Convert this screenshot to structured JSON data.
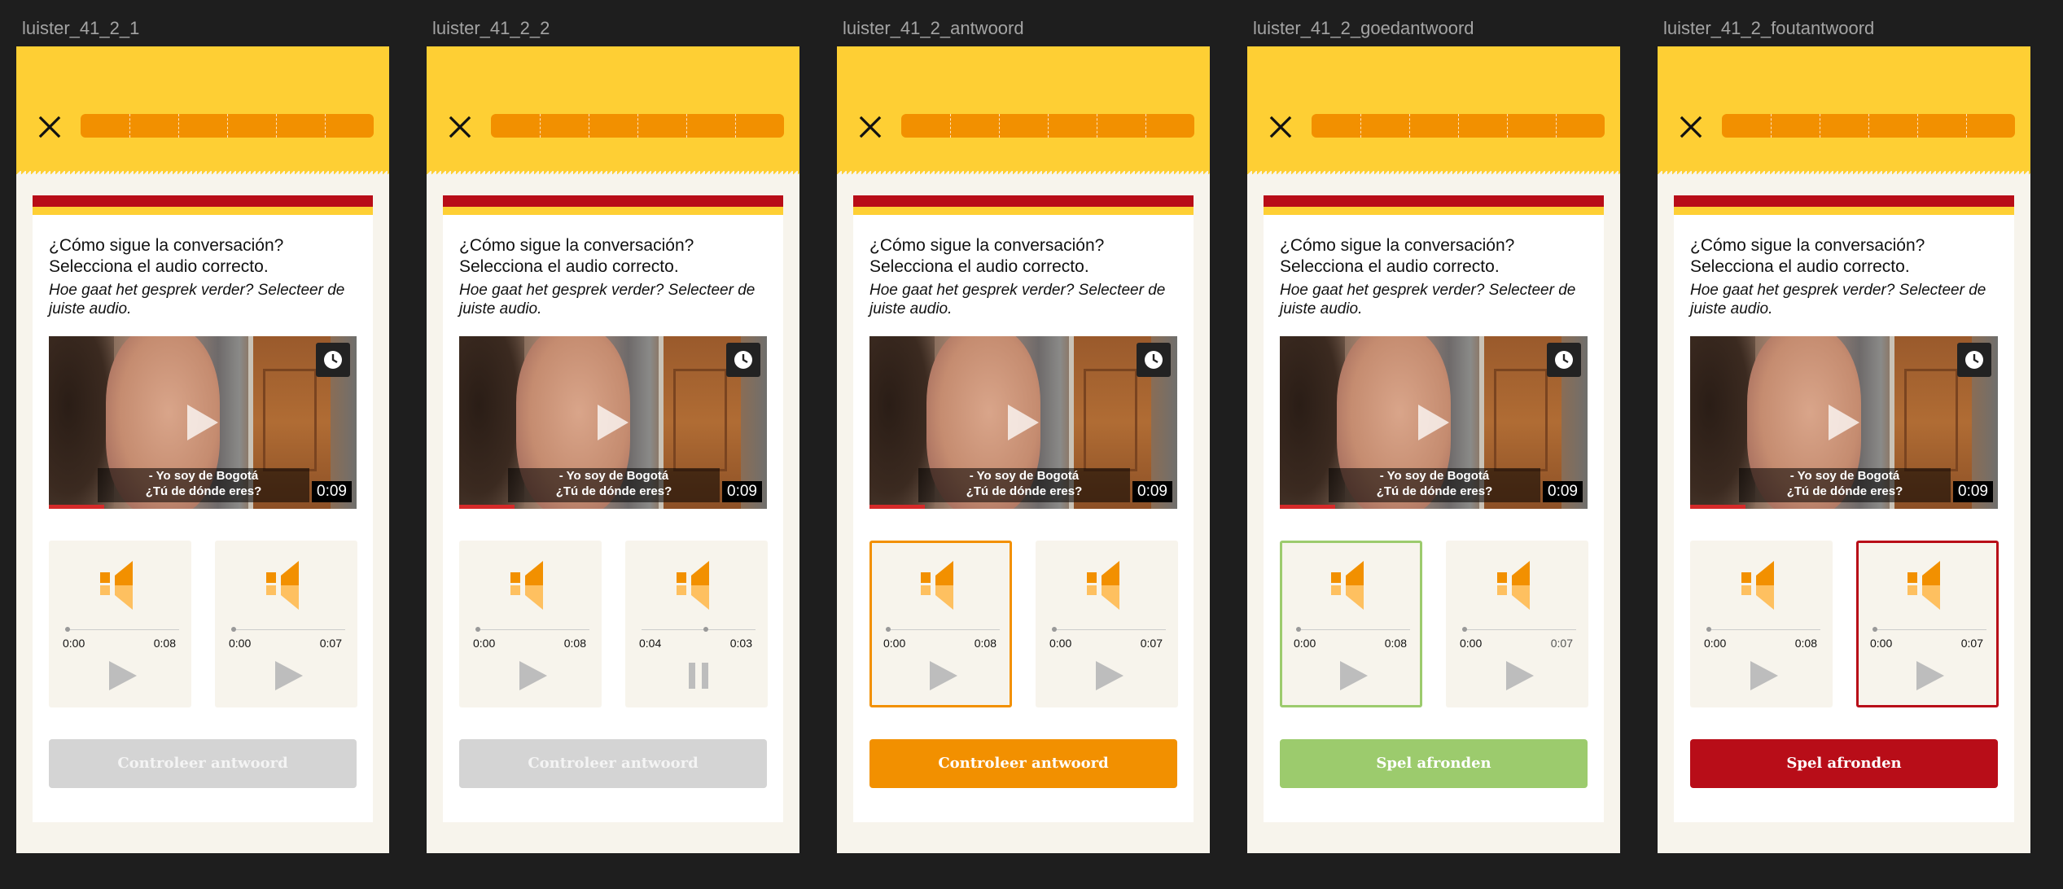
{
  "frames": [
    {
      "label": "luister_41_2_1",
      "question_es": "¿Cómo sigue la conversación? Selecciona el audio correcto.",
      "question_nl": "Hoe gaat het gesprek verder? Selecteer de juiste audio.",
      "video": {
        "subtitle_line1": "- Yo soy de Bogotá",
        "subtitle_line2": "¿Tú de dónde eres?",
        "duration": "0:09"
      },
      "audio_a": {
        "start": "0:00",
        "end": "0:08",
        "state": "play",
        "selected": "none",
        "progress": 0
      },
      "audio_b": {
        "start": "0:00",
        "end": "0:07",
        "state": "play",
        "selected": "none",
        "progress": 0
      },
      "button": {
        "label": "Controleer antwoord",
        "state": "disabled",
        "color": "#d4d4d4"
      }
    },
    {
      "label": "luister_41_2_2",
      "question_es": "¿Cómo sigue la conversación? Selecciona el audio correcto.",
      "question_nl": "Hoe gaat het gesprek verder? Selecteer de juiste audio.",
      "video": {
        "subtitle_line1": "- Yo soy de Bogotá",
        "subtitle_line2": "¿Tú de dónde eres?",
        "duration": "0:09"
      },
      "audio_a": {
        "start": "0:00",
        "end": "0:08",
        "state": "play",
        "selected": "none",
        "progress": 0
      },
      "audio_b": {
        "start": "0:04",
        "end": "0:03",
        "state": "pause",
        "selected": "none",
        "progress": 0.57
      },
      "button": {
        "label": "Controleer antwoord",
        "state": "disabled",
        "color": "#d4d4d4"
      }
    },
    {
      "label": "luister_41_2_antwoord",
      "question_es": "¿Cómo sigue la conversación? Selecciona el audio correcto.",
      "question_nl": "Hoe gaat het gesprek verder? Selecteer de juiste audio.",
      "video": {
        "subtitle_line1": "- Yo soy de Bogotá",
        "subtitle_line2": "¿Tú de dónde eres?",
        "duration": "0:09"
      },
      "audio_a": {
        "start": "0:00",
        "end": "0:08",
        "state": "play",
        "selected": "orange",
        "progress": 0
      },
      "audio_b": {
        "start": "0:00",
        "end": "0:07",
        "state": "play",
        "selected": "none",
        "progress": 0
      },
      "button": {
        "label": "Controleer antwoord",
        "state": "enabled",
        "color": "#f29000"
      }
    },
    {
      "label": "luister_41_2_goedantwoord",
      "question_es": "¿Cómo sigue la conversación? Selecciona el audio correcto.",
      "question_nl": "Hoe gaat het gesprek verder? Selecteer de juiste audio.",
      "video": {
        "subtitle_line1": "- Yo soy de Bogotá",
        "subtitle_line2": "¿Tú de dónde eres?",
        "duration": "0:09"
      },
      "audio_a": {
        "start": "0:00",
        "end": "0:08",
        "state": "play",
        "selected": "green",
        "progress": 0
      },
      "audio_b": {
        "start": "0:00",
        "end": "0:07",
        "state": "play",
        "selected": "none",
        "progress": 0,
        "end_grey": true
      },
      "button": {
        "label": "Spel afronden",
        "state": "enabled",
        "color": "#9ccb6d"
      }
    },
    {
      "label": "luister_41_2_foutantwoord",
      "question_es": "¿Cómo sigue la conversación? Selecciona el audio correcto.",
      "question_nl": "Hoe gaat het gesprek verder? Selecteer de juiste audio.",
      "video": {
        "subtitle_line1": "- Yo soy de Bogotá",
        "subtitle_line2": "¿Tú de dónde eres?",
        "duration": "0:09"
      },
      "audio_a": {
        "start": "0:00",
        "end": "0:08",
        "state": "play",
        "selected": "none",
        "progress": 0
      },
      "audio_b": {
        "start": "0:00",
        "end": "0:07",
        "state": "play",
        "selected": "red",
        "progress": 0
      },
      "button": {
        "label": "Spel afronden",
        "state": "enabled",
        "color": "#b80d18"
      }
    }
  ],
  "colors": {
    "background": "#1e1e1e",
    "topbar": "#fecf34",
    "progress": "#f29000",
    "flag_red": "#b80d18",
    "screen_bg": "#f7f4ec"
  },
  "icons": [
    "close-icon",
    "clock-icon",
    "play-icon",
    "speaker-icon",
    "pause-icon"
  ]
}
